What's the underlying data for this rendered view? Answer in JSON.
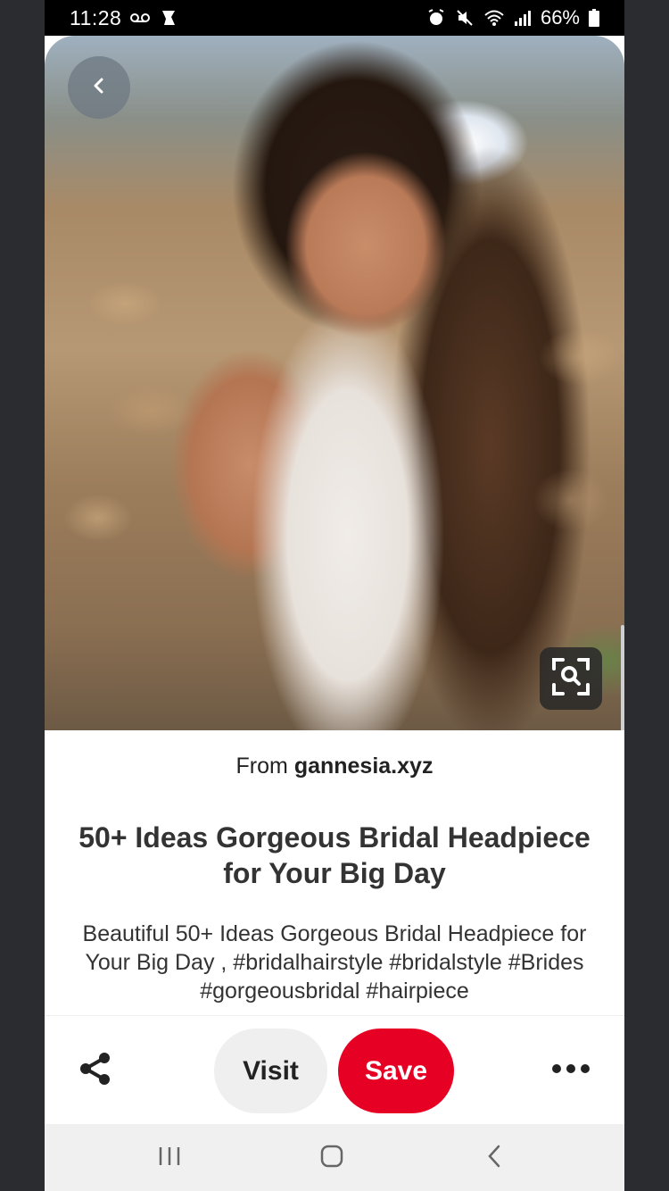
{
  "status_bar": {
    "time": "11:28",
    "battery": "66%"
  },
  "pin": {
    "source_prefix": "From ",
    "source_domain": "gannesia.xyz",
    "title": "50+ Ideas Gorgeous Bridal Headpiece for Your Big Day",
    "description": "Beautiful 50+ Ideas Gorgeous Bridal Headpiece for Your Big Day ,  #bridalhairstyle #bridalstyle #Brides #gorgeousbridal #hairpiece"
  },
  "actions": {
    "visit_label": "Visit",
    "save_label": "Save"
  },
  "colors": {
    "save_red": "#e60023",
    "visit_gray": "#efefef",
    "status_bar": "#000000",
    "nav_bar": "#f0f0f0"
  },
  "icons": {
    "back": "chevron-left-icon",
    "visual_search": "lens-search-icon",
    "share": "share-icon",
    "more": "more-horizontal-icon",
    "nav_recents": "recents-icon",
    "nav_home": "home-icon",
    "nav_back": "nav-back-icon"
  }
}
